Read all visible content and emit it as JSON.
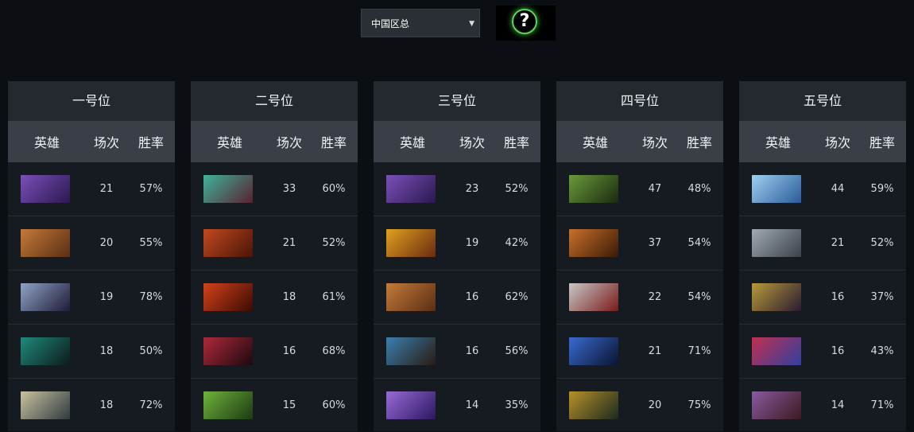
{
  "region": {
    "selected": "中国区总"
  },
  "help": {
    "label": "?"
  },
  "columns": {
    "hero": "英雄",
    "matches": "场次",
    "winrate": "胜率"
  },
  "positions": [
    {
      "title": "一号位",
      "rows": [
        {
          "hero_icon": "purple-faceless-hero",
          "matches": "21",
          "winrate": "57%"
        },
        {
          "hero_icon": "brown-warrior-hero",
          "matches": "20",
          "winrate": "55%"
        },
        {
          "hero_icon": "dark-haired-sorceress-hero",
          "matches": "19",
          "winrate": "78%"
        },
        {
          "hero_icon": "teal-dark-assassin-hero",
          "matches": "18",
          "winrate": "50%"
        },
        {
          "hero_icon": "pale-spear-hero",
          "matches": "18",
          "winrate": "72%"
        }
      ]
    },
    {
      "title": "二号位",
      "rows": [
        {
          "hero_icon": "green-haired-vampire-hero",
          "matches": "33",
          "winrate": "60%"
        },
        {
          "hero_icon": "red-armored-dragon-knight-hero",
          "matches": "21",
          "winrate": "52%"
        },
        {
          "hero_icon": "red-fire-demon-hero",
          "matches": "18",
          "winrate": "61%"
        },
        {
          "hero_icon": "dark-queen-hero",
          "matches": "16",
          "winrate": "68%"
        },
        {
          "hero_icon": "green-serpent-hero",
          "matches": "15",
          "winrate": "60%"
        }
      ]
    },
    {
      "title": "三号位",
      "rows": [
        {
          "hero_icon": "purple-faceless-hero",
          "matches": "23",
          "winrate": "52%"
        },
        {
          "hero_icon": "golden-monkey-hero",
          "matches": "19",
          "winrate": "42%"
        },
        {
          "hero_icon": "brown-warrior-hero",
          "matches": "16",
          "winrate": "62%"
        },
        {
          "hero_icon": "blue-horned-beast-hero",
          "matches": "16",
          "winrate": "56%"
        },
        {
          "hero_icon": "violet-mage-hero",
          "matches": "14",
          "winrate": "35%"
        }
      ]
    },
    {
      "title": "四号位",
      "rows": [
        {
          "hero_icon": "green-armored-hero",
          "matches": "47",
          "winrate": "48%"
        },
        {
          "hero_icon": "bearded-dwarf-hero",
          "matches": "37",
          "winrate": "54%"
        },
        {
          "hero_icon": "white-robot-hero",
          "matches": "22",
          "winrate": "54%"
        },
        {
          "hero_icon": "blue-night-stalker-hero",
          "matches": "21",
          "winrate": "71%"
        },
        {
          "hero_icon": "golden-helmet-hero",
          "matches": "20",
          "winrate": "75%"
        }
      ]
    },
    {
      "title": "五号位",
      "rows": [
        {
          "hero_icon": "ice-crystal-hero",
          "matches": "44",
          "winrate": "59%"
        },
        {
          "hero_icon": "grey-undead-hero",
          "matches": "21",
          "winrate": "52%"
        },
        {
          "hero_icon": "gold-dark-priest-hero",
          "matches": "16",
          "winrate": "37%"
        },
        {
          "hero_icon": "red-blue-shaman-hero",
          "matches": "16",
          "winrate": "43%"
        },
        {
          "hero_icon": "horned-demon-hero",
          "matches": "14",
          "winrate": "71%"
        }
      ]
    }
  ],
  "hero_colors": {
    "purple-faceless-hero": [
      "#7b4fb8",
      "#2a1950"
    ],
    "brown-warrior-hero": [
      "#c47a3a",
      "#5a2e14"
    ],
    "dark-haired-sorceress-hero": [
      "#8fa3c6",
      "#201a36"
    ],
    "teal-dark-assassin-hero": [
      "#1f8a7a",
      "#0d1a1c"
    ],
    "pale-spear-hero": [
      "#c9c2a0",
      "#2f3a40"
    ],
    "green-haired-vampire-hero": [
      "#3fb39a",
      "#5a2030"
    ],
    "red-armored-dragon-knight-hero": [
      "#c2481f",
      "#4a1508"
    ],
    "red-fire-demon-hero": [
      "#d4421a",
      "#3b0b05"
    ],
    "dark-queen-hero": [
      "#b0283a",
      "#1a0a10"
    ],
    "green-serpent-hero": [
      "#6fb33a",
      "#1c3a14"
    ],
    "golden-monkey-hero": [
      "#e0a020",
      "#6a2a10"
    ],
    "blue-horned-beast-hero": [
      "#3a7fb0",
      "#2a1a10"
    ],
    "violet-mage-hero": [
      "#9a6ad8",
      "#2a1860"
    ],
    "green-armored-hero": [
      "#6a9a3a",
      "#1a2a10"
    ],
    "bearded-dwarf-hero": [
      "#c8702a",
      "#3a1a08"
    ],
    "white-robot-hero": [
      "#c8c8c8",
      "#7a1a1a"
    ],
    "blue-night-stalker-hero": [
      "#3a6ad0",
      "#0a1430"
    ],
    "golden-helmet-hero": [
      "#b8902a",
      "#1a2a20"
    ],
    "ice-crystal-hero": [
      "#9fd0f0",
      "#2a5a9a"
    ],
    "grey-undead-hero": [
      "#a0aab0",
      "#3a4048"
    ],
    "gold-dark-priest-hero": [
      "#b89a3a",
      "#2a1a30"
    ],
    "red-blue-shaman-hero": [
      "#c03050",
      "#3040a0"
    ],
    "horned-demon-hero": [
      "#8a5aa0",
      "#3a1a20"
    ]
  }
}
